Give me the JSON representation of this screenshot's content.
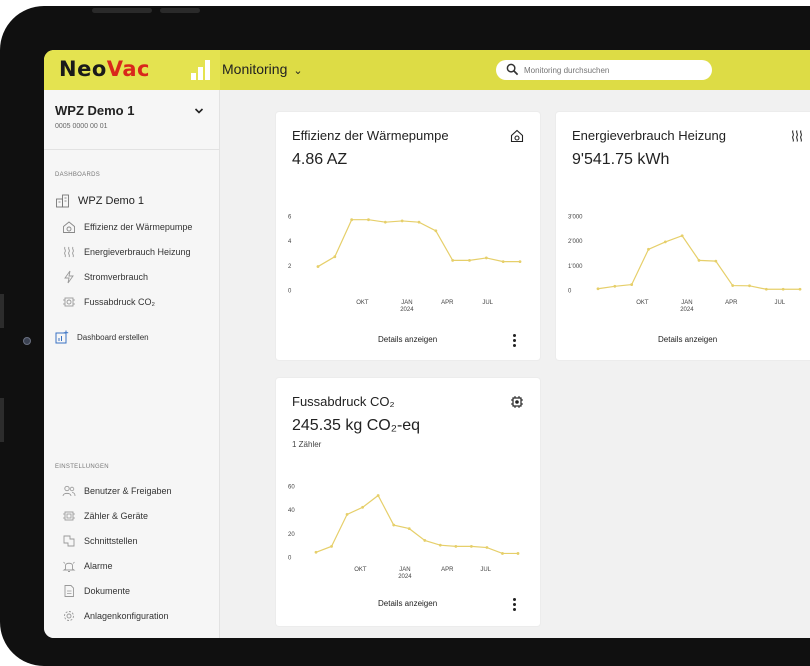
{
  "brand": {
    "name_part1": "Neo",
    "name_part2": "Vac"
  },
  "topbar": {
    "module_label": "Monitoring",
    "search_placeholder": "Monitoring durchsuchen"
  },
  "account": {
    "name": "WPZ Demo 1",
    "id": "0005 0000 00 01"
  },
  "sidebar": {
    "dashboards_heading": "DASHBOARDS",
    "root_item": "WPZ Demo 1",
    "dashboard_items": [
      {
        "label": "Effizienz der Wärmepumpe",
        "icon": "heatpump-icon"
      },
      {
        "label": "Energieverbrauch Heizung",
        "icon": "heating-icon"
      },
      {
        "label": "Stromverbrauch",
        "icon": "lightning-icon"
      },
      {
        "label": "Fussabdruck CO₂",
        "icon": "co2-icon"
      }
    ],
    "create_dashboard": "Dashboard erstellen",
    "settings_heading": "EINSTELLUNGEN",
    "settings_items": [
      {
        "label": "Benutzer & Freigaben",
        "icon": "users-icon"
      },
      {
        "label": "Zähler & Geräte",
        "icon": "meter-icon"
      },
      {
        "label": "Schnittstellen",
        "icon": "interface-icon"
      },
      {
        "label": "Alarme",
        "icon": "alarm-icon"
      },
      {
        "label": "Dokumente",
        "icon": "document-icon"
      },
      {
        "label": "Anlagenkonfiguration",
        "icon": "gear-icon"
      }
    ]
  },
  "cards": [
    {
      "title": "Effizienz der Wärmepumpe",
      "value": "4.86 AZ",
      "details_label": "Details anzeigen",
      "icon": "heatpump-icon"
    },
    {
      "title": "Energieverbrauch Heizung",
      "value": "9'541.75 kWh",
      "details_label": "Details anzeigen",
      "icon": "heating-icon"
    },
    {
      "title": "Fussabdruck CO₂",
      "value": "245.35 kg CO₂-eq",
      "subtitle": "1 Zähler",
      "details_label": "Details anzeigen",
      "icon": "co2-icon"
    }
  ],
  "colors": {
    "accent": "#dddc45",
    "line": "#e6cf6a",
    "brand_red": "#d9271b"
  },
  "chart_data": [
    {
      "type": "line",
      "x_tick_labels": [
        "OKT",
        "JAN 2024",
        "APR",
        "JUL"
      ],
      "yticks": [
        0,
        2,
        4,
        6
      ],
      "ylim": [
        0,
        6
      ],
      "grid": false,
      "series": [
        {
          "values": [
            1.9,
            2.7,
            5.7,
            5.7,
            5.5,
            5.6,
            5.5,
            4.8,
            2.4,
            2.4,
            2.6,
            2.3,
            2.3
          ]
        }
      ]
    },
    {
      "type": "line",
      "x_tick_labels": [
        "OKT",
        "JAN 2024",
        "APR",
        "JUL"
      ],
      "yticks": [
        "0",
        "1'000",
        "2'000",
        "3'000"
      ],
      "ylim": [
        0,
        3000
      ],
      "grid": false,
      "series": [
        {
          "values": [
            50,
            150,
            220,
            1650,
            1950,
            2200,
            1200,
            1170,
            180,
            170,
            30,
            30,
            30
          ]
        }
      ]
    },
    {
      "type": "line",
      "x_tick_labels": [
        "OKT",
        "JAN 2024",
        "APR",
        "JUL"
      ],
      "yticks": [
        0,
        20,
        40,
        60
      ],
      "ylim": [
        0,
        60
      ],
      "grid": false,
      "series": [
        {
          "values": [
            4,
            9,
            36,
            42,
            52,
            27,
            24,
            14,
            10,
            9,
            9,
            8,
            3,
            3
          ]
        }
      ]
    }
  ]
}
